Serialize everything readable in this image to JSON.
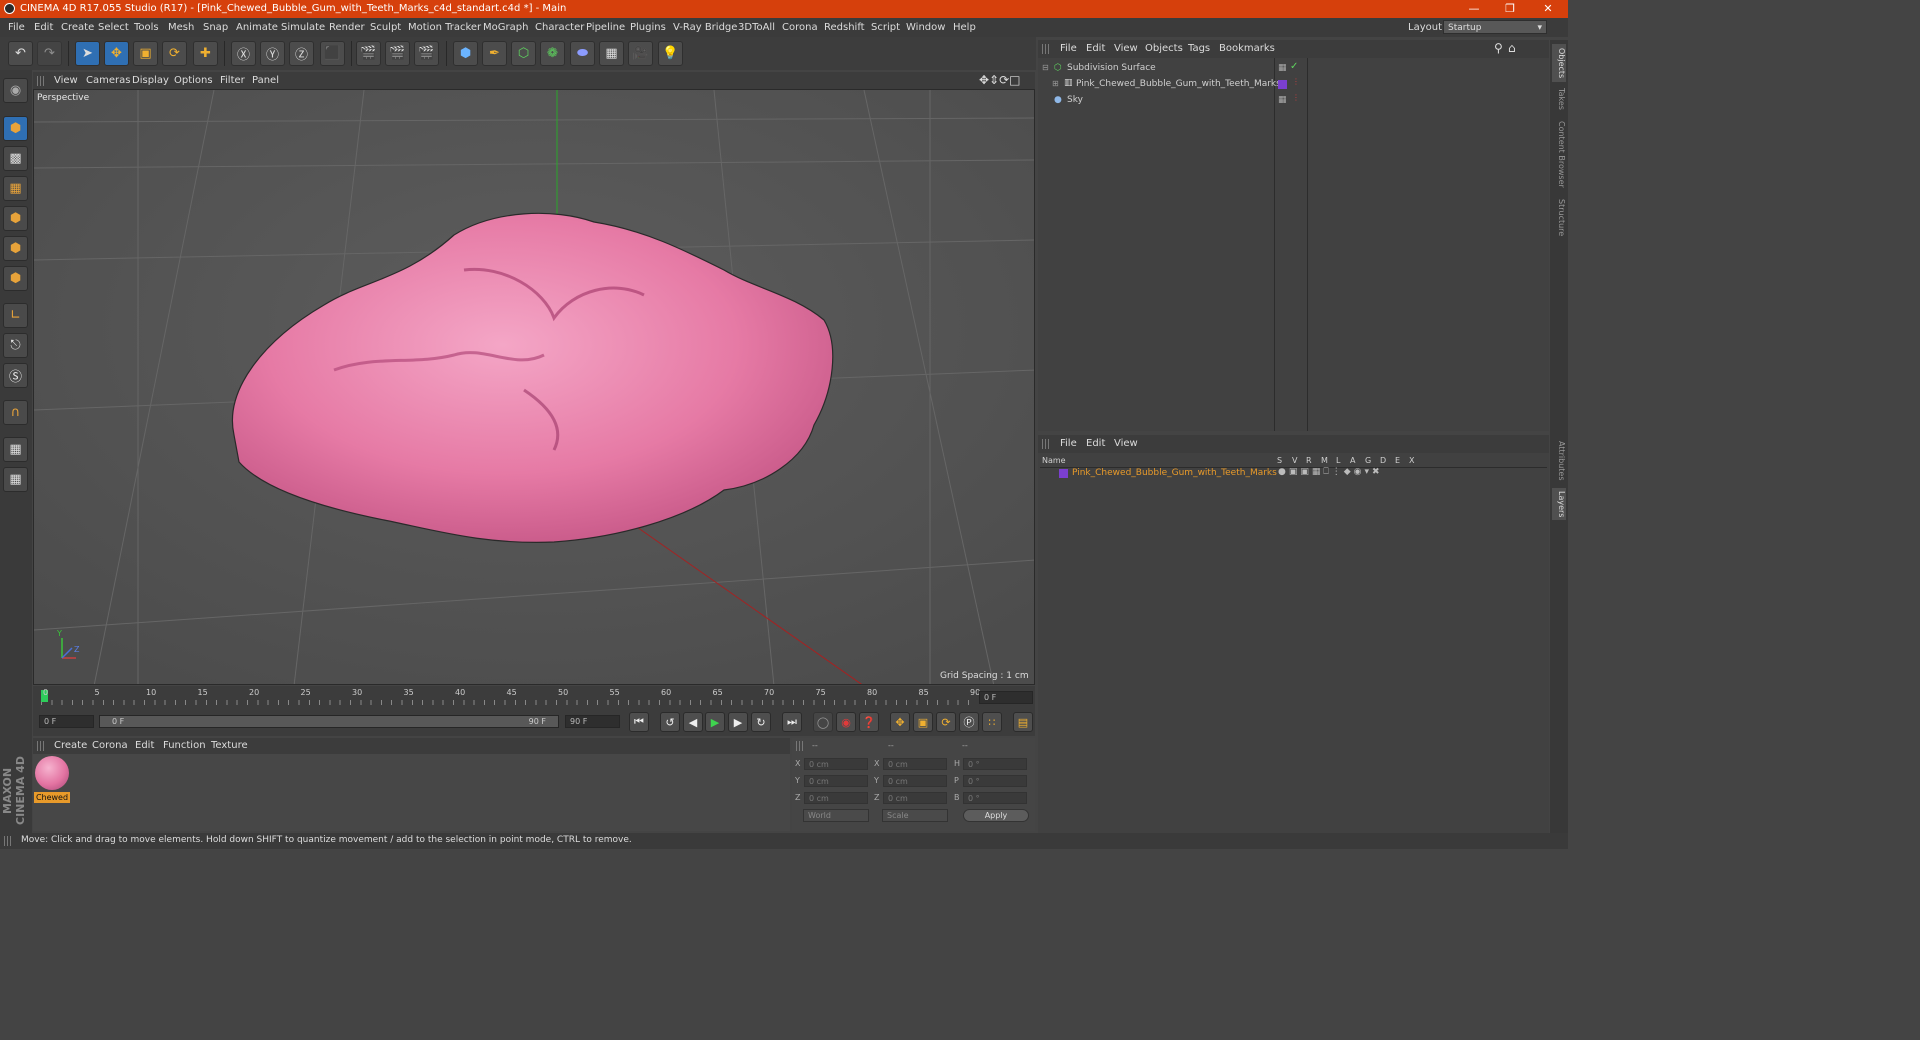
{
  "app": {
    "title": "CINEMA 4D R17.055 Studio (R17) - [Pink_Chewed_Bubble_Gum_with_Teeth_Marks_c4d_standart.c4d *] - Main",
    "layout_label": "Layout:",
    "layout_value": "Startup"
  },
  "menubar": [
    "File",
    "Edit",
    "Create",
    "Select",
    "Tools",
    "Mesh",
    "Snap",
    "Animate",
    "Simulate",
    "Render",
    "Sculpt",
    "Motion Tracker",
    "MoGraph",
    "Character",
    "Pipeline",
    "Plugins",
    "V-Ray Bridge",
    "3DToAll",
    "Corona",
    "Redshift",
    "Script",
    "Window",
    "Help"
  ],
  "viewport": {
    "menu": [
      "View",
      "Cameras",
      "Display",
      "Options",
      "Filter",
      "Panel"
    ],
    "label": "Perspective",
    "grid_spacing": "Grid Spacing : 1 cm",
    "axis_y": "Y",
    "axis_z": "Z"
  },
  "timeline": {
    "ticks": [
      "0",
      "5",
      "10",
      "15",
      "20",
      "25",
      "30",
      "35",
      "40",
      "45",
      "50",
      "55",
      "60",
      "65",
      "70",
      "75",
      "80",
      "85",
      "90"
    ],
    "current_frame": "0 F",
    "start_field": "0 F",
    "range_start": "0 F",
    "range_end": "90 F",
    "end_field": "90 F"
  },
  "material_manager": {
    "menu": [
      "Create",
      "Corona",
      "Edit",
      "Function",
      "Texture"
    ],
    "materials": [
      {
        "name": "Chewed"
      }
    ]
  },
  "coordinates": {
    "header": [
      "--",
      "--",
      "--"
    ],
    "rows": [
      {
        "l1": "X",
        "v1": "0 cm",
        "l2": "X",
        "v2": "0 cm",
        "l3": "H",
        "v3": "0 °"
      },
      {
        "l1": "Y",
        "v1": "0 cm",
        "l2": "Y",
        "v2": "0 cm",
        "l3": "P",
        "v3": "0 °"
      },
      {
        "l1": "Z",
        "v1": "0 cm",
        "l2": "Z",
        "v2": "0 cm",
        "l3": "B",
        "v3": "0 °"
      }
    ],
    "mode1": "World",
    "mode2": "Scale",
    "apply": "Apply"
  },
  "object_manager": {
    "menu": [
      "File",
      "Edit",
      "View",
      "Objects",
      "Tags",
      "Bookmarks"
    ],
    "objects": [
      {
        "name": "Subdivision Surface"
      },
      {
        "name": "Pink_Chewed_Bubble_Gum_with_Teeth_Marks"
      },
      {
        "name": "Sky"
      }
    ]
  },
  "layer_manager": {
    "menu": [
      "File",
      "Edit",
      "View"
    ],
    "columns": [
      "Name",
      "S",
      "V",
      "R",
      "M",
      "L",
      "A",
      "G",
      "D",
      "E",
      "X"
    ],
    "layers": [
      {
        "name": "Pink_Chewed_Bubble_Gum_with_Teeth_Marks",
        "color": "#7b3fd0"
      }
    ]
  },
  "right_tabs": [
    "Objects",
    "Takes",
    "Content Browser",
    "Structure",
    "Attributes",
    "Layers"
  ],
  "status": "Move: Click and drag to move elements. Hold down SHIFT to quantize movement / add to the selection in point mode, CTRL to remove.",
  "colors": {
    "accent": "#d6400c",
    "selection": "#2f6fb3",
    "gum": "#e87aa6",
    "active_layer": "#e89a2a"
  }
}
